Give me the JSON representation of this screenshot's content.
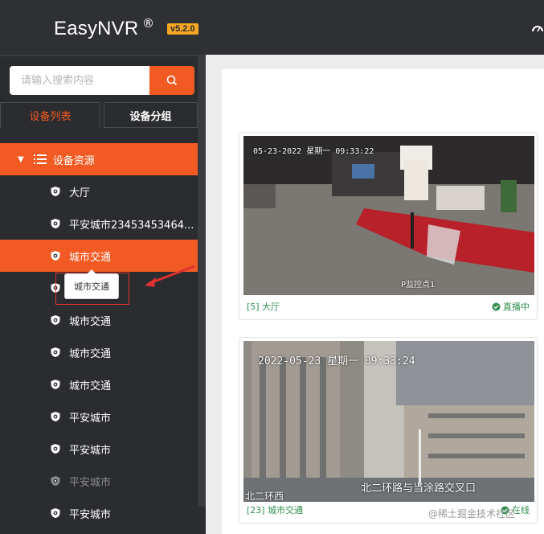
{
  "header": {
    "brand": "EasyNVR",
    "registered": "®",
    "version": "v5.2.0"
  },
  "sidebar": {
    "search_placeholder": "请输入搜索内容",
    "tabs": [
      "设备列表",
      "设备分组"
    ],
    "tree_root": "设备资源",
    "items": [
      {
        "label": "大厅"
      },
      {
        "label": "平安城市23453453464..."
      },
      {
        "label": "城市交通",
        "active": true
      },
      {
        "label": "城市交通"
      },
      {
        "label": "城市交通"
      },
      {
        "label": "城市交通"
      },
      {
        "label": "城市交通"
      },
      {
        "label": "平安城市"
      },
      {
        "label": "平安城市"
      },
      {
        "label": "平安城市",
        "muted": true
      },
      {
        "label": "平安城市"
      }
    ],
    "tooltip": "城市交通"
  },
  "cards": [
    {
      "name": "[5] 大厅",
      "status": "直播中",
      "osd_time": "05-23-2022 星期一 09:33:22",
      "osd_label": "P监控点1"
    },
    {
      "name": "[23] 城市交通",
      "status": "在线",
      "osd_time": "2022-05-23 星期一 09:33:24",
      "osd_left": "北二环西",
      "osd_caption": "北二环路与当涂路交叉口"
    }
  ],
  "watermark": "@稀土掘金技术社区",
  "colors": {
    "accent": "#f15a22",
    "header_bg": "#2f3033",
    "sidebar_bg": "#2b2c2f",
    "version_badge": "#f5a623",
    "status_green": "#2f8f4e"
  }
}
